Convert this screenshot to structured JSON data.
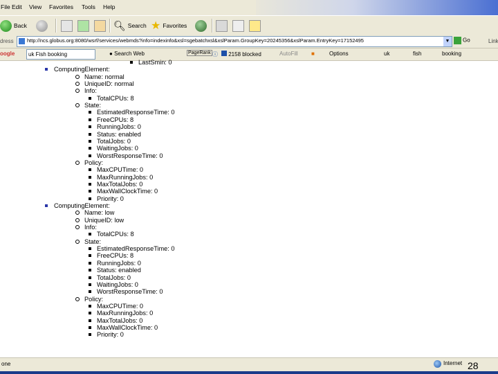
{
  "menu": [
    "File",
    "Edit",
    "View",
    "Favorites",
    "Tools",
    "Help"
  ],
  "toolbar": {
    "back": "Back",
    "search": "Search",
    "favorites": "Favorites"
  },
  "address": {
    "label": "dress",
    "url": "http://ncs.globus.org:8080/wsrf/services/webmds?info=indexinfo&xsl=sgebatchxsl&xslParam.GroupKey=20245356&xslParam.EntryKey=17152495",
    "go": "Go",
    "links": "Links"
  },
  "google": {
    "logo": "oogle",
    "query": "uk Fish booking",
    "search_web": "Search Web",
    "pagerank": "PageRank",
    "blocked": "2158 blocked",
    "autofill": "AutoFill",
    "options": "Options",
    "w1": "uk",
    "w2": "fish",
    "w3": "booking"
  },
  "tree": [
    {
      "t": "LastSmin: 0",
      "l": 3
    },
    {
      "t": "ComputingElement:",
      "l": 0
    },
    {
      "t": "Name: normal",
      "l": 1
    },
    {
      "t": "UniqueID: normal",
      "l": 1
    },
    {
      "t": "Info:",
      "l": 1
    },
    {
      "t": "TotalCPUs: 8",
      "l": 2
    },
    {
      "t": "State:",
      "l": 1
    },
    {
      "t": "EstimatedResponseTime: 0",
      "l": 2
    },
    {
      "t": "FreeCPUs: 8",
      "l": 2
    },
    {
      "t": "RunningJobs: 0",
      "l": 2
    },
    {
      "t": "Status: enabled",
      "l": 2
    },
    {
      "t": "TotalJobs: 0",
      "l": 2
    },
    {
      "t": "WaitingJobs: 0",
      "l": 2
    },
    {
      "t": "WorstResponseTime: 0",
      "l": 2
    },
    {
      "t": "Policy:",
      "l": 1
    },
    {
      "t": "MaxCPUTime: 0",
      "l": 2
    },
    {
      "t": "MaxRunningJobs: 0",
      "l": 2
    },
    {
      "t": "MaxTotalJobs: 0",
      "l": 2
    },
    {
      "t": "MaxWallClockTime: 0",
      "l": 2
    },
    {
      "t": "Priority: 0",
      "l": 2
    },
    {
      "t": "ComputingElement:",
      "l": 0
    },
    {
      "t": "Name: low",
      "l": 1
    },
    {
      "t": "UniqueID: low",
      "l": 1
    },
    {
      "t": "Info:",
      "l": 1
    },
    {
      "t": "TotalCPUs: 8",
      "l": 2
    },
    {
      "t": "State:",
      "l": 1
    },
    {
      "t": "EstimatedResponseTime: 0",
      "l": 2
    },
    {
      "t": "FreeCPUs: 8",
      "l": 2
    },
    {
      "t": "RunningJobs: 0",
      "l": 2
    },
    {
      "t": "Status: enabled",
      "l": 2
    },
    {
      "t": "TotalJobs: 0",
      "l": 2
    },
    {
      "t": "WaitingJobs: 0",
      "l": 2
    },
    {
      "t": "WorstResponseTime: 0",
      "l": 2
    },
    {
      "t": "Policy:",
      "l": 1
    },
    {
      "t": "MaxCPUTime: 0",
      "l": 2
    },
    {
      "t": "MaxRunningJobs: 0",
      "l": 2
    },
    {
      "t": "MaxTotalJobs: 0",
      "l": 2
    },
    {
      "t": "MaxWallClockTime: 0",
      "l": 2
    },
    {
      "t": "Priority: 0",
      "l": 2
    }
  ],
  "status": {
    "left": "one",
    "zone": "Internet"
  },
  "slide_number": "28"
}
